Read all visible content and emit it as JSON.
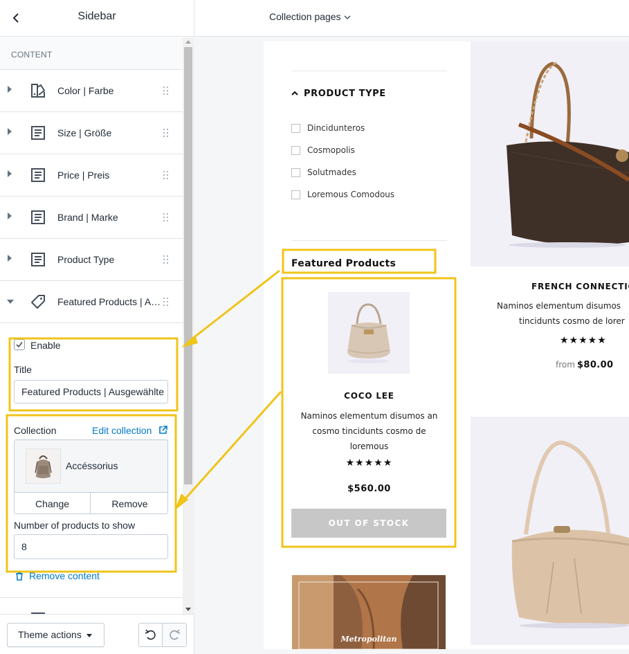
{
  "sidebar": {
    "title": "Sidebar",
    "section_label": "CONTENT",
    "items": [
      {
        "label": "Color | Farbe",
        "icon": "swatch-icon"
      },
      {
        "label": "Size | Größe",
        "icon": "text-block-icon"
      },
      {
        "label": "Price | Preis",
        "icon": "text-block-icon"
      },
      {
        "label": "Brand | Marke",
        "icon": "text-block-icon"
      },
      {
        "label": "Product Type",
        "icon": "text-block-icon"
      },
      {
        "label": "Featured Products | Ausgewählte Produkte",
        "icon": "tag-icon"
      }
    ],
    "featured": {
      "enable_label": "Enable",
      "enabled": true,
      "title_label": "Title",
      "title_value": "Featured Products | Ausgewählte Produkte",
      "collection_label": "Collection",
      "edit_collection": "Edit collection",
      "collection_name": "Accéssorius",
      "change_label": "Change",
      "remove_label": "Remove",
      "num_products_label": "Number of products to show",
      "num_products_value": "8",
      "remove_content": "Remove content"
    },
    "footer": {
      "theme_actions": "Theme actions"
    }
  },
  "topbar": {
    "page_select": "Collection pages"
  },
  "preview": {
    "product_type_heading": "PRODUCT TYPE",
    "product_type_options": [
      "Dincidunteros",
      "Cosmopolis",
      "Solutmades",
      "Loremous Comodous"
    ],
    "featured_heading": "Featured Products",
    "featured_product": {
      "name": "COCO LEE",
      "description": "Naminos elementum disumos an cosmo tincidunts cosmo de loremous",
      "stars": "★★★★★",
      "rating": 5,
      "price": "$560.00",
      "button": "OUT OF STOCK"
    },
    "promo_text": "Metropolitan",
    "grid_product": {
      "name": "FRENCH CONNECTIO",
      "desc_line1": "Naminos elementum disumos",
      "desc_line2": "tincidunts cosmo de lorer",
      "stars": "★★★★★",
      "rating": 5,
      "price_prefix": "from",
      "price": "$80.00"
    }
  },
  "colors": {
    "annotation": "#f0c419",
    "link": "#007ace",
    "out_of_stock": "#c7c7c7",
    "image_bg": "#f1f0f7"
  }
}
